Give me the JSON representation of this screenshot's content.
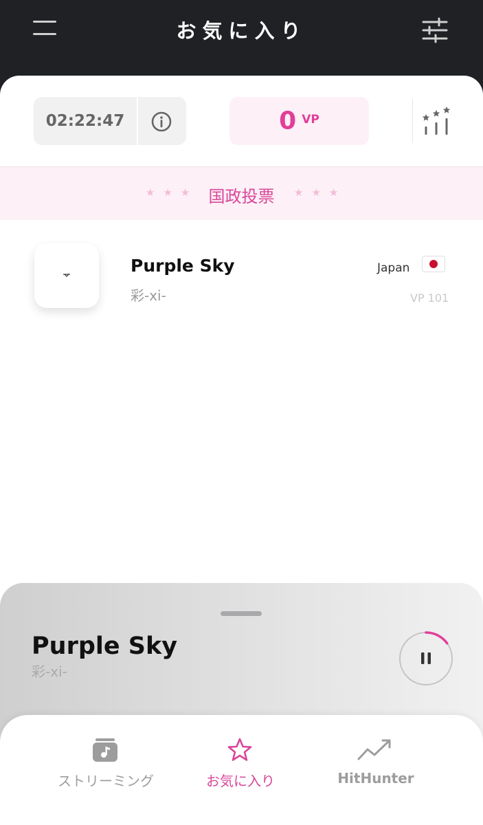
{
  "header": {
    "title": "お気に入り",
    "menu_icon": "hamburger-icon",
    "filter_icon": "sliders-icon"
  },
  "stats": {
    "timer": "02:22:47",
    "info_icon": "info-icon",
    "vp_value": "0",
    "vp_unit": "VP",
    "ranking_icon": "ranking-stars-icon"
  },
  "banner": {
    "stars_left": "★★★",
    "label": "国政投票",
    "stars_right": "★★★"
  },
  "favorites": [
    {
      "title": "Purple Sky",
      "artist": "彩-xi-",
      "country": "Japan",
      "flag_icon": "japan-flag-icon",
      "vp": "VP 101"
    }
  ],
  "now_playing": {
    "title": "Purple Sky",
    "artist": "彩-xi-",
    "state": "playing",
    "progress_fraction": 0.15
  },
  "bottom_nav": [
    {
      "label": "ストリーミング",
      "icon": "music-box-icon",
      "active": false
    },
    {
      "label": "お気に入り",
      "icon": "star-icon",
      "active": true
    },
    {
      "label": "HitHunter",
      "icon": "trend-up-icon",
      "active": false
    }
  ],
  "colors": {
    "accent": "#d9479a",
    "header_bg": "#1f2124",
    "banner_bg": "#fdf0f6"
  }
}
